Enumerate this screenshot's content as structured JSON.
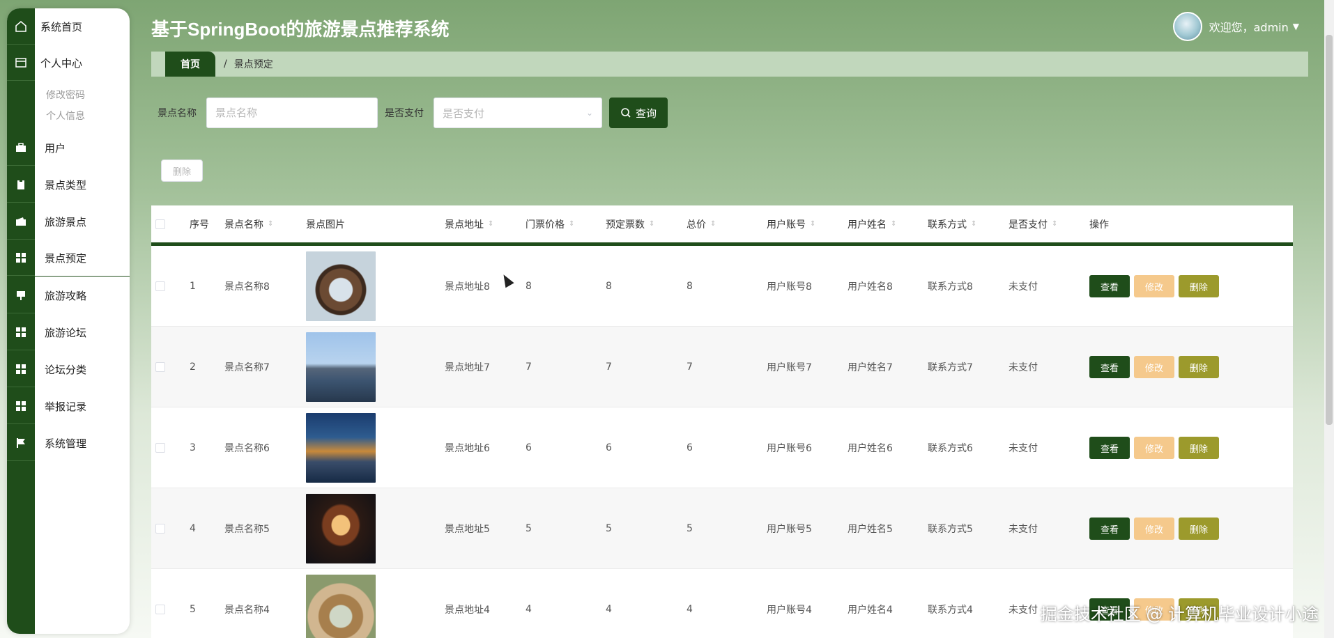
{
  "app": {
    "title": "基于SpringBoot的旅游景点推荐系统"
  },
  "user": {
    "welcome": "欢迎您，admin"
  },
  "sidebar": {
    "items": [
      {
        "label": "系统首页",
        "icon": "home-icon"
      },
      {
        "label": "个人中心",
        "icon": "window-icon"
      },
      {
        "label": "用户",
        "icon": "briefcase-icon"
      },
      {
        "label": "景点类型",
        "icon": "clipboard-icon"
      },
      {
        "label": "旅游景点",
        "icon": "wallet-icon"
      },
      {
        "label": "景点预定",
        "icon": "grid-icon"
      },
      {
        "label": "旅游攻略",
        "icon": "easel-icon"
      },
      {
        "label": "旅游论坛",
        "icon": "grid-icon"
      },
      {
        "label": "论坛分类",
        "icon": "grid-icon"
      },
      {
        "label": "举报记录",
        "icon": "grid-icon"
      },
      {
        "label": "系统管理",
        "icon": "flag-icon"
      }
    ],
    "sub_items": [
      "修改密码",
      "个人信息"
    ]
  },
  "breadcrumb": {
    "home": "首页",
    "separator": "/",
    "current": "景点预定"
  },
  "search": {
    "name_label": "景点名称",
    "name_placeholder": "景点名称",
    "paid_label": "是否支付",
    "paid_placeholder": "是否支付",
    "query_button": "查询"
  },
  "toolbar": {
    "delete_label": "删除"
  },
  "table": {
    "headers": [
      "序号",
      "景点名称",
      "景点图片",
      "景点地址",
      "门票价格",
      "预定票数",
      "总价",
      "用户账号",
      "用户姓名",
      "联系方式",
      "是否支付",
      "操作"
    ],
    "rows": [
      {
        "no": "1",
        "name": "景点名称8",
        "address": "景点地址8",
        "price": "8",
        "tickets": "8",
        "total": "8",
        "account": "用户账号8",
        "username": "用户姓名8",
        "contact": "联系方式8",
        "paid": "未支付"
      },
      {
        "no": "2",
        "name": "景点名称7",
        "address": "景点地址7",
        "price": "7",
        "tickets": "7",
        "total": "7",
        "account": "用户账号7",
        "username": "用户姓名7",
        "contact": "联系方式7",
        "paid": "未支付"
      },
      {
        "no": "3",
        "name": "景点名称6",
        "address": "景点地址6",
        "price": "6",
        "tickets": "6",
        "total": "6",
        "account": "用户账号6",
        "username": "用户姓名6",
        "contact": "联系方式6",
        "paid": "未支付"
      },
      {
        "no": "4",
        "name": "景点名称5",
        "address": "景点地址5",
        "price": "5",
        "tickets": "5",
        "total": "5",
        "account": "用户账号5",
        "username": "用户姓名5",
        "contact": "联系方式5",
        "paid": "未支付"
      },
      {
        "no": "5",
        "name": "景点名称4",
        "address": "景点地址4",
        "price": "4",
        "tickets": "4",
        "total": "4",
        "account": "用户账号4",
        "username": "用户姓名4",
        "contact": "联系方式4",
        "paid": "未支付"
      }
    ],
    "actions": {
      "view": "查看",
      "edit": "修改",
      "delete": "删除"
    }
  },
  "watermark": "掘金技术社区 @ 计算机毕业设计小途",
  "colors": {
    "primary": "#1f4d1a",
    "edit": "#f5c98c",
    "delete": "#9c9a2c",
    "breadcrumb_bg": "#c1d7bc"
  }
}
